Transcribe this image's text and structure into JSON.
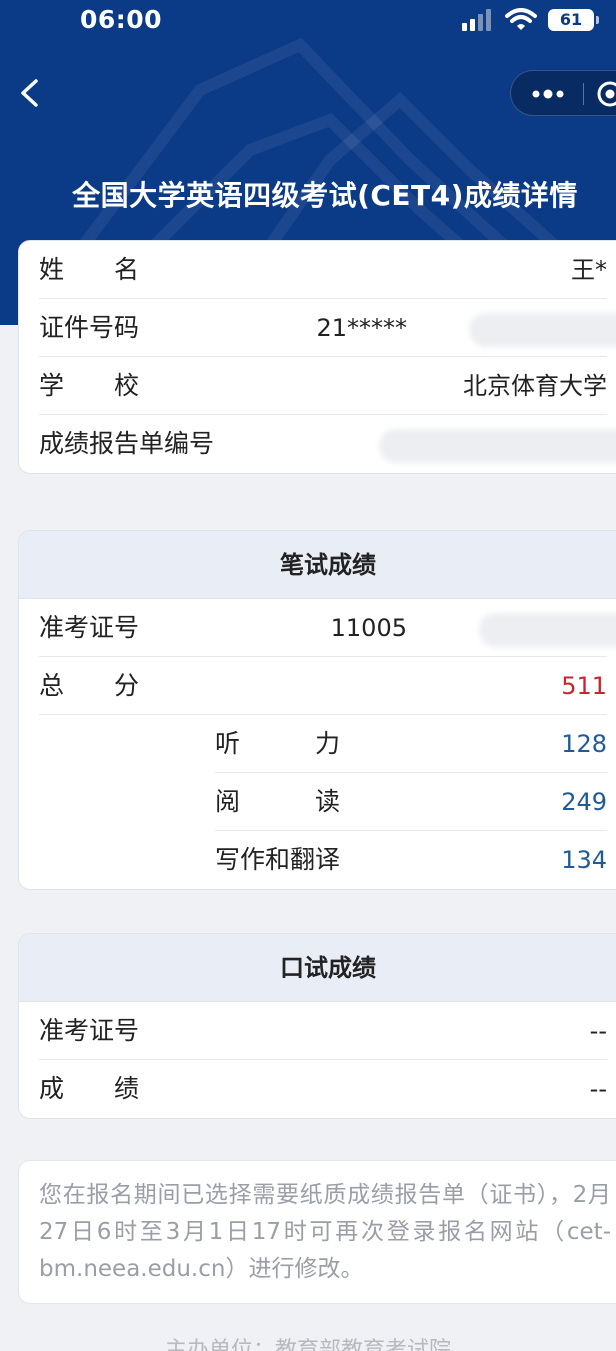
{
  "status_bar": {
    "time": "06:00",
    "battery": "61"
  },
  "nav": {
    "title": "全国大学英语四级考试(CET4)成绩详情"
  },
  "personal_info": {
    "rows": [
      {
        "label": "姓　　名",
        "value": "王*"
      },
      {
        "label": "证件号码",
        "value": "21*****"
      },
      {
        "label": "学　　校",
        "value": "北京体育大学"
      },
      {
        "label": "成绩报告单编号",
        "value": ""
      }
    ]
  },
  "written_exam": {
    "title": "笔试成绩",
    "ticket_label": "准考证号",
    "ticket_value": "11005",
    "total_label": "总　　分",
    "total_value": "511",
    "sub_scores": [
      {
        "label": "听　　　力",
        "value": "128"
      },
      {
        "label": "阅　　　读",
        "value": "249"
      },
      {
        "label": "写作和翻译",
        "value": "134"
      }
    ]
  },
  "oral_exam": {
    "title": "口试成绩",
    "ticket_label": "准考证号",
    "ticket_value": "--",
    "score_label": "成　　绩",
    "score_value": "--"
  },
  "notice": {
    "text": "您在报名期间已选择需要纸质成绩报告单（证书），2月27日6时至3月1日17时可再次登录报名网站（cet-bm.neea.edu.cn）进行修改。"
  },
  "footer": {
    "text": "主办单位：教育部教育考试院"
  },
  "colors": {
    "header_bg": "#0b3a86",
    "total_score": "#c6272c",
    "sub_score": "#1f5a9a"
  }
}
